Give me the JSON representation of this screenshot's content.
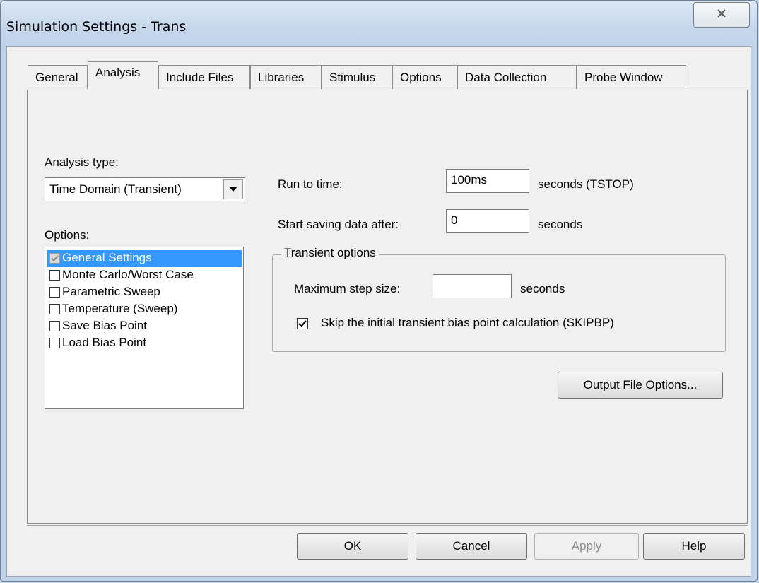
{
  "window": {
    "title": "Simulation Settings - Trans"
  },
  "tabs": [
    {
      "label": "General",
      "active": false
    },
    {
      "label": "Analysis",
      "active": true
    },
    {
      "label": "Include Files",
      "active": false
    },
    {
      "label": "Libraries",
      "active": false
    },
    {
      "label": "Stimulus",
      "active": false
    },
    {
      "label": "Options",
      "active": false
    },
    {
      "label": "Data Collection",
      "active": false
    },
    {
      "label": "Probe Window",
      "active": false
    }
  ],
  "analysis": {
    "type_label": "Analysis type:",
    "type_value": "Time Domain (Transient)",
    "options_label": "Options:",
    "options": [
      {
        "label": "General Settings",
        "checked": true,
        "selected": true
      },
      {
        "label": "Monte Carlo/Worst Case",
        "checked": false,
        "selected": false
      },
      {
        "label": "Parametric Sweep",
        "checked": false,
        "selected": false
      },
      {
        "label": "Temperature (Sweep)",
        "checked": false,
        "selected": false
      },
      {
        "label": "Save Bias Point",
        "checked": false,
        "selected": false
      },
      {
        "label": "Load Bias Point",
        "checked": false,
        "selected": false
      }
    ]
  },
  "settings": {
    "run_to_time_label": "Run to time:",
    "run_to_time_value": "100ms",
    "run_to_time_unit": "seconds  (TSTOP)",
    "start_saving_label": "Start saving data after:",
    "start_saving_value": "0",
    "start_saving_unit": "seconds"
  },
  "transient": {
    "group_label": "Transient options",
    "max_step_label": "Maximum step size:",
    "max_step_value": "",
    "max_step_unit": "seconds",
    "skip_bias_label": "Skip the initial transient bias point calculation  (SKIPBP)",
    "skip_bias_checked": true
  },
  "buttons": {
    "output_file_options": "Output File Options...",
    "ok": "OK",
    "cancel": "Cancel",
    "apply": "Apply",
    "help": "Help"
  }
}
